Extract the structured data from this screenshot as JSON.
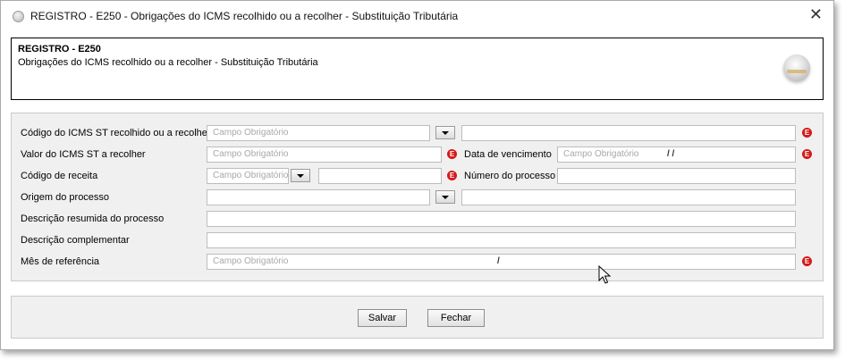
{
  "window": {
    "title": "REGISTRO - E250 - Obrigações do ICMS recolhido ou a recolher - Substituição Tributária",
    "close_label": "✕"
  },
  "header": {
    "title": "REGISTRO - E250",
    "subtitle": "Obrigações do ICMS recolhido ou a recolher - Substituição Tributária"
  },
  "form": {
    "codigo_icms_label": "Código do ICMS ST recolhido ou a recolher",
    "codigo_icms_placeholder": "Campo Obrigatório",
    "codigo_icms_desc": "",
    "valor_icms_label": "Valor do ICMS ST a recolher",
    "valor_icms_placeholder": "Campo Obrigatório",
    "data_venc_label": "Data de vencimento",
    "data_venc_placeholder": "Campo Obrigatório",
    "data_venc_mask": "/ /",
    "codigo_receita_label": "Código de receita",
    "codigo_receita_placeholder": "Campo Obrigatório",
    "codigo_receita_desc": "",
    "numero_processo_label": "Número do processo",
    "numero_processo_value": "",
    "origem_label": "Origem do processo",
    "origem_value": "",
    "origem_desc": "",
    "desc_resumida_label": "Descrição resumida do processo",
    "desc_resumida_value": "",
    "desc_compl_label": "Descrição complementar",
    "desc_compl_value": "",
    "mes_ref_label": "Mês de referência",
    "mes_ref_placeholder": "Campo Obrigatório",
    "mes_ref_mask": "/",
    "error_glyph": "E"
  },
  "buttons": {
    "save_label": "Salvar",
    "close_label": "Fechar"
  }
}
